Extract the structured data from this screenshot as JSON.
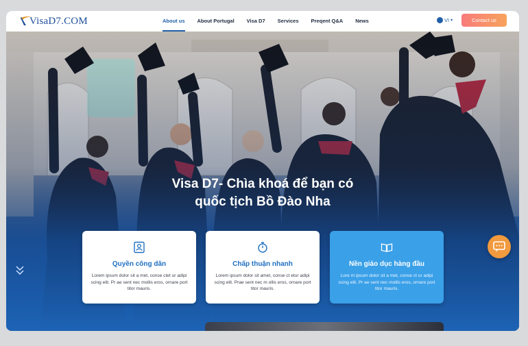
{
  "header": {
    "logo_text": "VisaD7.COM",
    "nav": [
      {
        "label": "About us",
        "active": true
      },
      {
        "label": "About Portugal",
        "active": false
      },
      {
        "label": "Visa D7",
        "active": false
      },
      {
        "label": "Services",
        "active": false
      },
      {
        "label": "Preqent Q&A",
        "active": false
      },
      {
        "label": "News",
        "active": false
      }
    ],
    "language": "VI",
    "contact_label": "Contact us"
  },
  "hero": {
    "title_line1": "Visa D7- Chìa khoá để bạn có",
    "title_line2": "quốc tịch Bồ Đào Nha"
  },
  "cards": [
    {
      "icon": "id-card-icon",
      "title": "Quyền công dân",
      "text": "Lorem ipsum dolor sit a met, conse ctet ur adipi scing elit. Pr ae sent nec mollis eros, ornare port titor mauris."
    },
    {
      "icon": "stopwatch-icon",
      "title": "Chấp thuận nhanh",
      "text": "Lorem ipsum dolor sit amet, conse ct etur adipi scing elit. Prae sent nec m ollis eros, ornare port titor mauris."
    },
    {
      "icon": "open-book-icon",
      "title": "Nền giáo dục hàng đầu",
      "text": "Lore m ipsum dolor sit a met, conse ct ur adipi scing elit. Pr ae sent nec mollis eros, ornare port titor mauris."
    }
  ],
  "colors": {
    "accent": "#1f5fa6",
    "contact_gradient_start": "#f87b7b",
    "contact_gradient_end": "#f7a35c",
    "featured_card": "#3aa0e8",
    "chat_button": "#f19a3e"
  }
}
